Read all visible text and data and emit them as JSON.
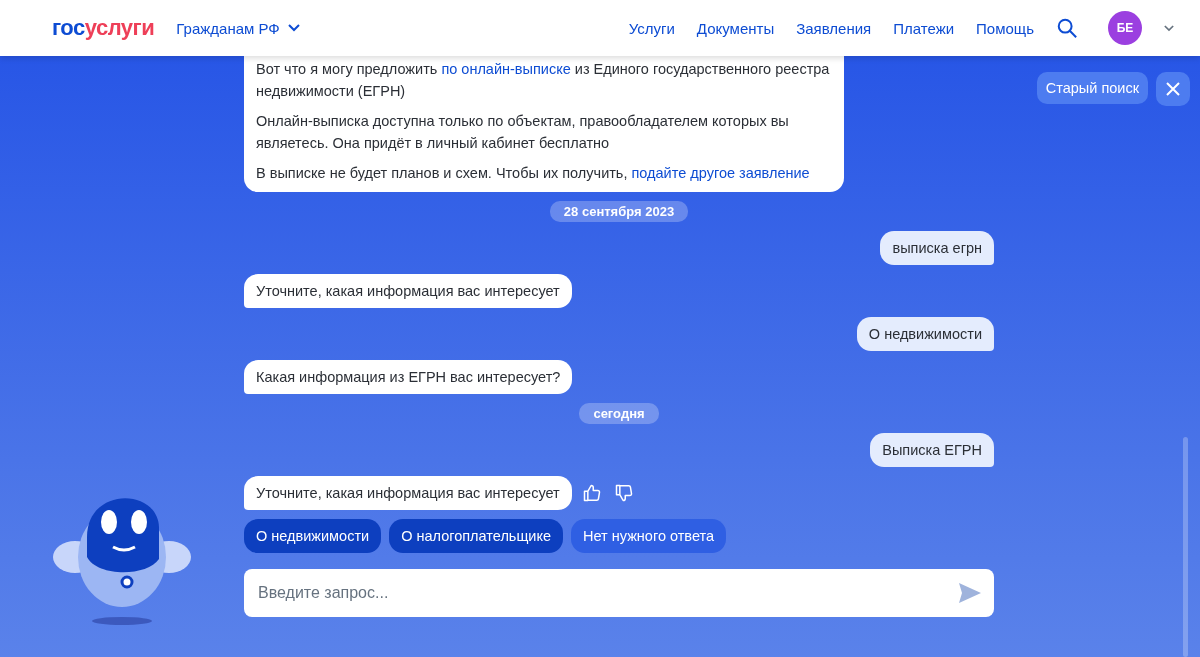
{
  "header": {
    "logo": {
      "part_1": "гос",
      "part_2": "услуги"
    },
    "region": "Гражданам РФ",
    "nav": [
      "Услуги",
      "Документы",
      "Заявления",
      "Платежи",
      "Помощь"
    ],
    "avatar": "БЕ"
  },
  "side_actions": {
    "old_search": "Старый поиск"
  },
  "messages": [
    {
      "kind": "bot_card",
      "paragraphs": [
        [
          {
            "text": "Вот что я могу предложить ",
            "link": false
          },
          {
            "text": "по онлайн-выписке",
            "link": true
          },
          {
            "text": " из Единого государственного реестра недвижимости (ЕГРН)",
            "link": false
          }
        ],
        [
          {
            "text": "Онлайн-выписка доступна только по объектам, правообладателем которых вы являетесь. Она придёт в личный кабинет бесплатно",
            "link": false
          }
        ],
        [
          {
            "text": "В выписке не будет планов и схем. Чтобы их получить, ",
            "link": false
          },
          {
            "text": "подайте другое заявление",
            "link": true
          }
        ]
      ]
    },
    {
      "kind": "date",
      "text": "28 сентября 2023"
    },
    {
      "kind": "user",
      "text": "выписка егрн"
    },
    {
      "kind": "bot",
      "text": "Уточните, какая информация вас интересует"
    },
    {
      "kind": "user",
      "text": "О недвижимости"
    },
    {
      "kind": "bot",
      "text": "Какая информация из ЕГРН вас интересует?"
    },
    {
      "kind": "date",
      "text": "сегодня"
    },
    {
      "kind": "user",
      "text": "Выписка ЕГРН"
    },
    {
      "kind": "bot_rated",
      "text": "Уточните, какая информация вас интересует"
    },
    {
      "kind": "replies",
      "options": [
        {
          "text": "О недвижимости",
          "selected": true
        },
        {
          "text": "О налогоплательщике",
          "selected": true
        },
        {
          "text": "Нет нужного ответа",
          "selected": false
        }
      ]
    }
  ],
  "input": {
    "placeholder": "Введите запрос..."
  }
}
